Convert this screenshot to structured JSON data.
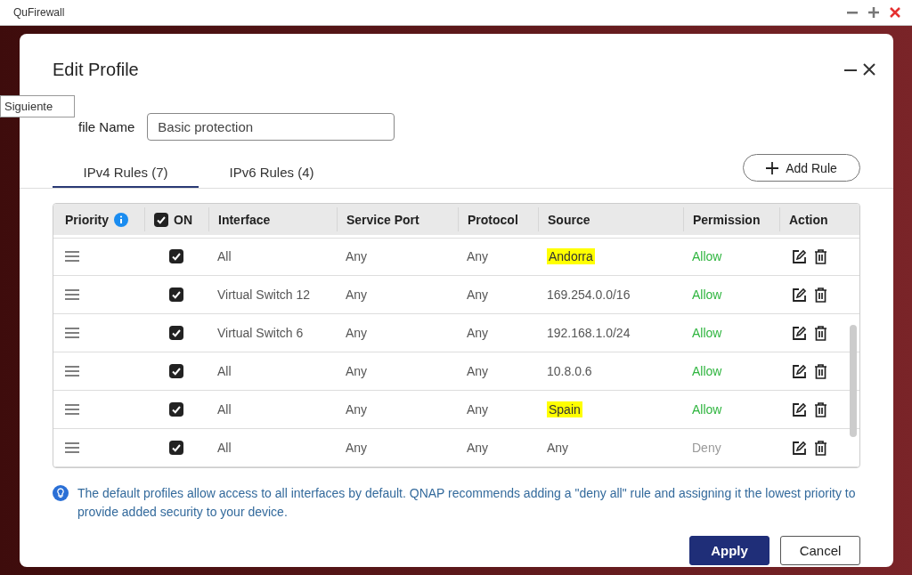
{
  "window": {
    "title": "QuFirewall"
  },
  "dialog": {
    "title": "Edit Profile",
    "profile_name_label": "file Name",
    "profile_name_value": "Basic protection",
    "tooltip": "Siguiente"
  },
  "tabs": [
    {
      "label": "IPv4 Rules (7)",
      "selected": true
    },
    {
      "label": "IPv6 Rules (4)",
      "selected": false
    }
  ],
  "add_rule_button": "Add Rule",
  "table": {
    "columns": [
      "Priority",
      "ON",
      "Interface",
      "Service Port",
      "Protocol",
      "Source",
      "Permission",
      "Action"
    ],
    "all_checked": true,
    "rows": [
      {
        "checked": true,
        "interface": "All",
        "service_port": "Any",
        "protocol": "Any",
        "source": "Andorra",
        "source_highlighted": true,
        "permission": "Allow",
        "kind": "allow"
      },
      {
        "checked": true,
        "interface": "Virtual Switch 12",
        "service_port": "Any",
        "protocol": "Any",
        "source": "169.254.0.0/16",
        "source_highlighted": false,
        "permission": "Allow",
        "kind": "allow"
      },
      {
        "checked": true,
        "interface": "Virtual Switch 6",
        "service_port": "Any",
        "protocol": "Any",
        "source": "192.168.1.0/24",
        "source_highlighted": false,
        "permission": "Allow",
        "kind": "allow"
      },
      {
        "checked": true,
        "interface": "All",
        "service_port": "Any",
        "protocol": "Any",
        "source": "10.8.0.6",
        "source_highlighted": false,
        "permission": "Allow",
        "kind": "allow"
      },
      {
        "checked": true,
        "interface": "All",
        "service_port": "Any",
        "protocol": "Any",
        "source": "Spain",
        "source_highlighted": true,
        "permission": "Allow",
        "kind": "allow"
      },
      {
        "checked": true,
        "interface": "All",
        "service_port": "Any",
        "protocol": "Any",
        "source": "Any",
        "source_highlighted": false,
        "permission": "Deny",
        "kind": "deny"
      }
    ]
  },
  "note": "The default profiles allow access to all interfaces by default. QNAP recommends adding a \"deny all\" rule and assigning it the lowest priority to provide added security to your device.",
  "buttons": [
    {
      "label": "Apply",
      "kind": "primary"
    },
    {
      "label": "Cancel",
      "kind": "secondary"
    }
  ]
}
